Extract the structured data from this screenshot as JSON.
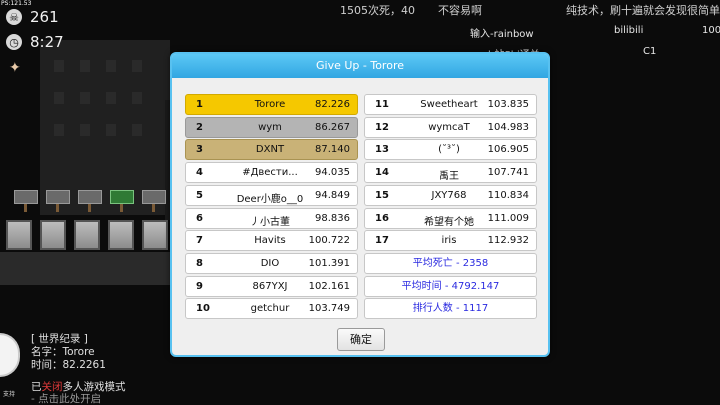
{
  "hud": {
    "fps_label": "PS:121.53",
    "deaths": "261",
    "time": "8:27"
  },
  "top_messages": [
    "1505次死，40",
    "不容易啊",
    "纯技术，刷十遍就会发现很简单"
  ],
  "right_chat": [
    "输入-rainbow",
    "bilibili",
    "100",
    "b站Shi通关",
    "C1"
  ],
  "record": {
    "header": "[ 世界纪录 ]",
    "name_line": "名字：Torore",
    "time_line": "时间：82.2261",
    "avatar_label": "支持"
  },
  "mode": {
    "prefix": "已",
    "highlight": "关闭",
    "suffix": "多人游戏模式",
    "hint": "- 点击此处开启"
  },
  "dialog": {
    "title": "Give Up - Torore",
    "ok_label": "确定",
    "left_column": [
      {
        "rank": "1",
        "name": "Torore",
        "score": "82.226"
      },
      {
        "rank": "2",
        "name": "wym",
        "score": "86.267"
      },
      {
        "rank": "3",
        "name": "DXNT",
        "score": "87.140"
      },
      {
        "rank": "4",
        "name": "#Двести...",
        "score": "94.035"
      },
      {
        "rank": "5",
        "name": "Deer小鹿o__0",
        "score": "94.849"
      },
      {
        "rank": "6",
        "name": "丿小古董",
        "score": "98.836"
      },
      {
        "rank": "7",
        "name": "Havits",
        "score": "100.722"
      },
      {
        "rank": "8",
        "name": "DIO",
        "score": "101.391"
      },
      {
        "rank": "9",
        "name": "867YXJ",
        "score": "102.161"
      },
      {
        "rank": "10",
        "name": "getchur",
        "score": "103.749"
      }
    ],
    "right_column": [
      {
        "rank": "11",
        "name": "Sweetheart",
        "score": "103.835"
      },
      {
        "rank": "12",
        "name": "wymcaT",
        "score": "104.983"
      },
      {
        "rank": "13",
        "name": "(˘³˘)",
        "score": "106.905"
      },
      {
        "rank": "14",
        "name": "禹王",
        "score": "107.741"
      },
      {
        "rank": "15",
        "name": "JXY768",
        "score": "110.834"
      },
      {
        "rank": "16",
        "name": "希望有个她",
        "score": "111.009"
      },
      {
        "rank": "17",
        "name": "iris",
        "score": "112.932"
      }
    ],
    "stats": [
      "平均死亡 - 2358",
      "平均时间 - 4792.147",
      "排行人数 - 1117"
    ]
  },
  "colors": {
    "title_bar": "#40b4ea",
    "gold": "#f5c800",
    "silver": "#b4b4b4",
    "bronze": "#c9b277",
    "stat_text": "#2a2ae0",
    "mode_highlight": "#e23a3a"
  }
}
